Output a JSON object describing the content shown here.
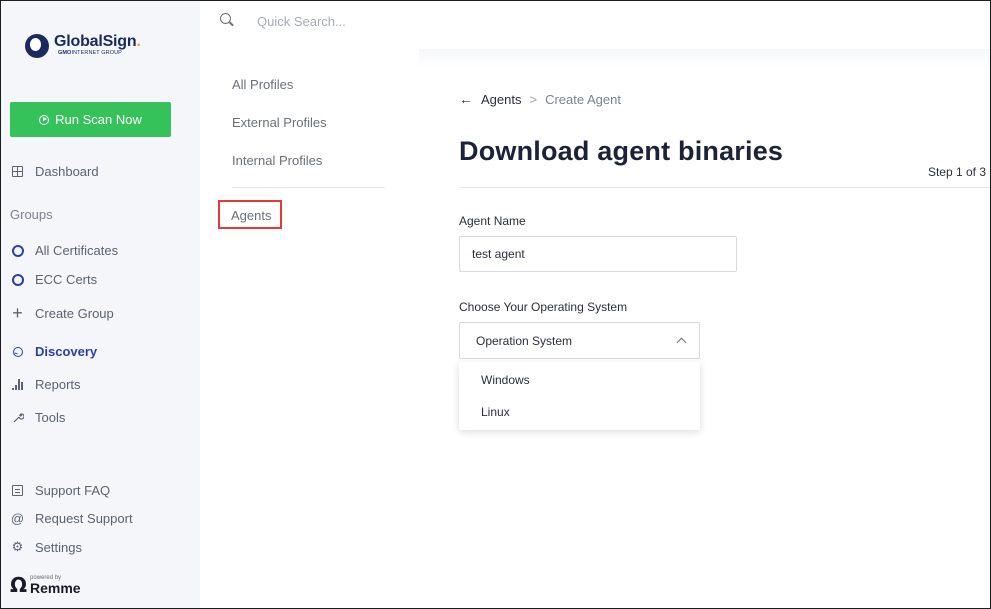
{
  "brand": {
    "name": "GlobalSign",
    "dot": ".",
    "sub_bold": "GMO",
    "sub_rest": "INTERNET GROUP"
  },
  "sidebar": {
    "run_scan_label": "Run Scan Now",
    "dashboard_label": "Dashboard",
    "groups_label": "Groups",
    "groups": [
      {
        "label": "All Certificates"
      },
      {
        "label": "ECC Certs"
      }
    ],
    "create_group_label": "Create Group",
    "discovery_label": "Discovery",
    "reports_label": "Reports",
    "tools_label": "Tools",
    "support_faq_label": "Support FAQ",
    "request_support_label": "Request Support",
    "settings_label": "Settings",
    "powered_by": "powered by",
    "powered_brand": "Remme"
  },
  "search": {
    "placeholder": "Quick Search..."
  },
  "subnav": {
    "items": [
      {
        "label": "All Profiles"
      },
      {
        "label": "External Profiles"
      },
      {
        "label": "Internal Profiles"
      }
    ],
    "agents_label": "Agents"
  },
  "main": {
    "breadcrumb": {
      "back": "←",
      "parent": "Agents",
      "separator": ">",
      "current": "Create Agent"
    },
    "title": "Download agent binaries",
    "step": "Step 1 of 3",
    "agent_name_label": "Agent Name",
    "agent_name_value": "test agent",
    "os_label": "Choose Your Operating System",
    "os_select_value": "Operation System",
    "os_options": [
      {
        "label": "Windows"
      },
      {
        "label": "Linux"
      }
    ]
  },
  "colors": {
    "accent": "#2b3fa8",
    "run_button": "#36c25a",
    "highlight_box": "#e53935"
  }
}
